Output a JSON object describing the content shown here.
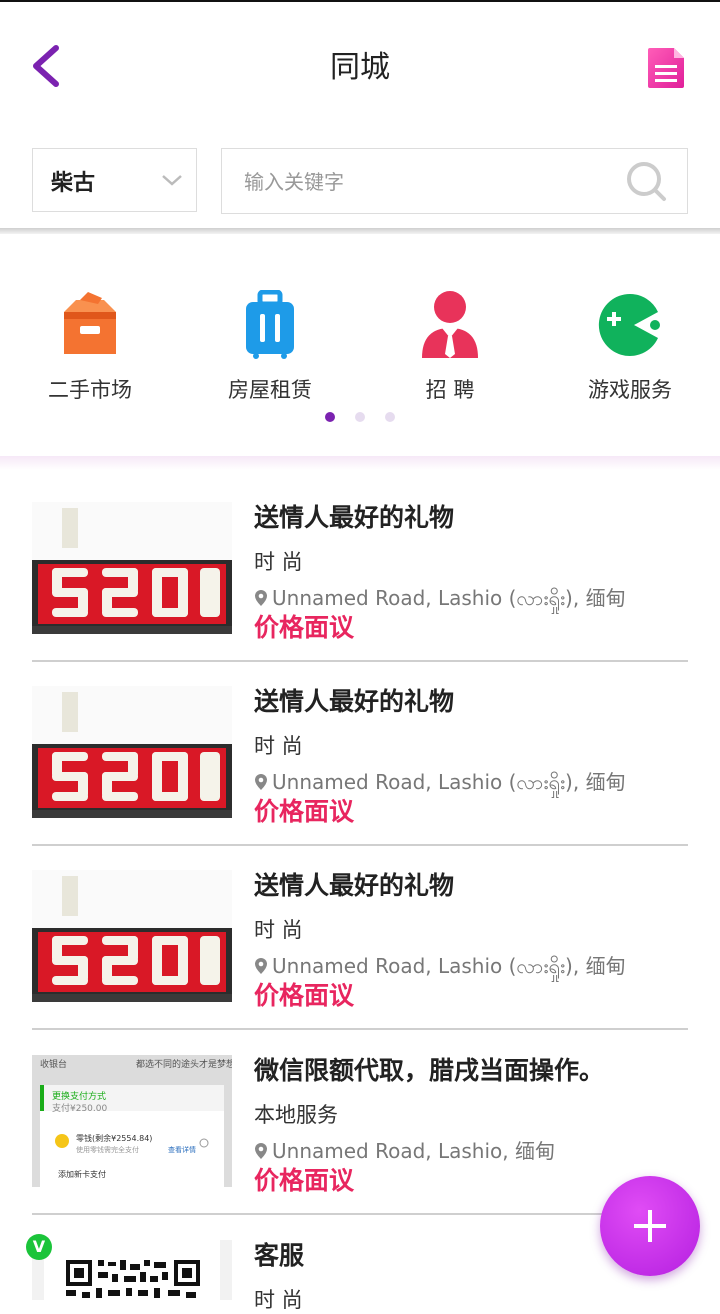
{
  "header": {
    "title": "同城"
  },
  "search": {
    "city": "柴古",
    "placeholder": "输入关键字"
  },
  "categories": [
    {
      "label": "二手市场",
      "icon": "box-icon",
      "color": "#f47331"
    },
    {
      "label": "房屋租赁",
      "icon": "suitcase-icon",
      "color": "#1e9be8"
    },
    {
      "label": "招 聘",
      "icon": "person-tie-icon",
      "color": "#e8335a"
    },
    {
      "label": "游戏服务",
      "icon": "gamepad-icon",
      "color": "#10b25c"
    }
  ],
  "pagination": {
    "pages": 3,
    "active": 1
  },
  "listings": [
    {
      "title": "送情人最好的礼物",
      "category": "时 尚",
      "location": "Unnamed Road, Lashio (လားရှိုး), 缅甸",
      "price": "价格面议",
      "image": "rose-box-520"
    },
    {
      "title": "送情人最好的礼物",
      "category": "时 尚",
      "location": "Unnamed Road, Lashio (လားရှိုး), 缅甸",
      "price": "价格面议",
      "image": "rose-box-520"
    },
    {
      "title": "送情人最好的礼物",
      "category": "时 尚",
      "location": "Unnamed Road, Lashio (လားရှိုး), 缅甸",
      "price": "价格面议",
      "image": "rose-box-520"
    },
    {
      "title": "微信限额代取，腊戌当面操作。",
      "category": "本地服务",
      "location": "Unnamed Road, Lashio, 缅甸",
      "price": "价格面议",
      "image": "payment-screenshot",
      "image_text": {
        "top_left": "收银台",
        "top_right": "都选不同的途头才是梦想",
        "method": "更换支付方式",
        "amount": "支付¥250.00",
        "balance": "零钱(剩余¥2554.84)",
        "balance_note": "使用零钱需完全支付",
        "detail": "查看详情",
        "add_card": "添加新卡支付"
      }
    },
    {
      "title": "客服",
      "category": "时 尚",
      "price": "",
      "image": "qr-code",
      "badge": "V"
    }
  ],
  "colors": {
    "accent": "#7b22b0",
    "price": "#e8265f",
    "fab": "#c52ae8"
  }
}
